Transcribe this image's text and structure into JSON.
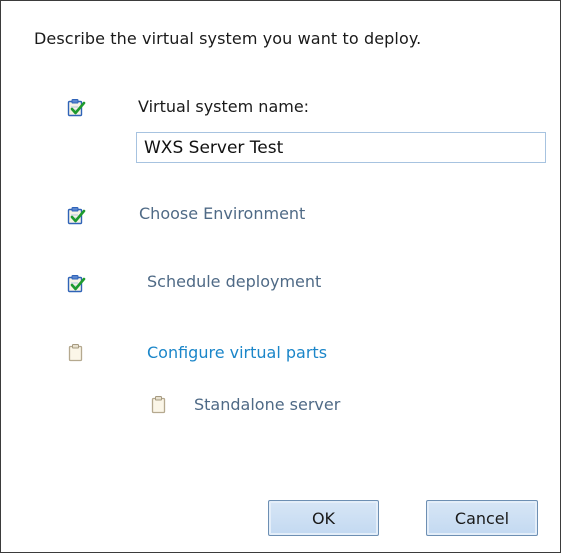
{
  "dialog": {
    "description": "Describe the virtual system you want to deploy.",
    "name_label": "Virtual system name:",
    "name_value": "WXS Server Test",
    "steps": [
      {
        "label": "Choose Environment",
        "status": "complete",
        "icon": "clipboard-check-icon"
      },
      {
        "label": "Schedule deployment",
        "status": "complete",
        "icon": "clipboard-check-icon"
      },
      {
        "label": "Configure virtual parts",
        "status": "incomplete",
        "icon": "clipboard-icon"
      }
    ],
    "parts": [
      {
        "label": "Standalone server",
        "status": "incomplete",
        "icon": "clipboard-icon"
      }
    ],
    "ok_label": "OK",
    "cancel_label": "Cancel"
  },
  "colors": {
    "check_green": "#1e9a2e",
    "clipboard_blue": "#2f63b8",
    "link_blue": "#1b86c9",
    "done_gray_blue": "#4f6a86",
    "button_border": "#6d8fb3"
  }
}
